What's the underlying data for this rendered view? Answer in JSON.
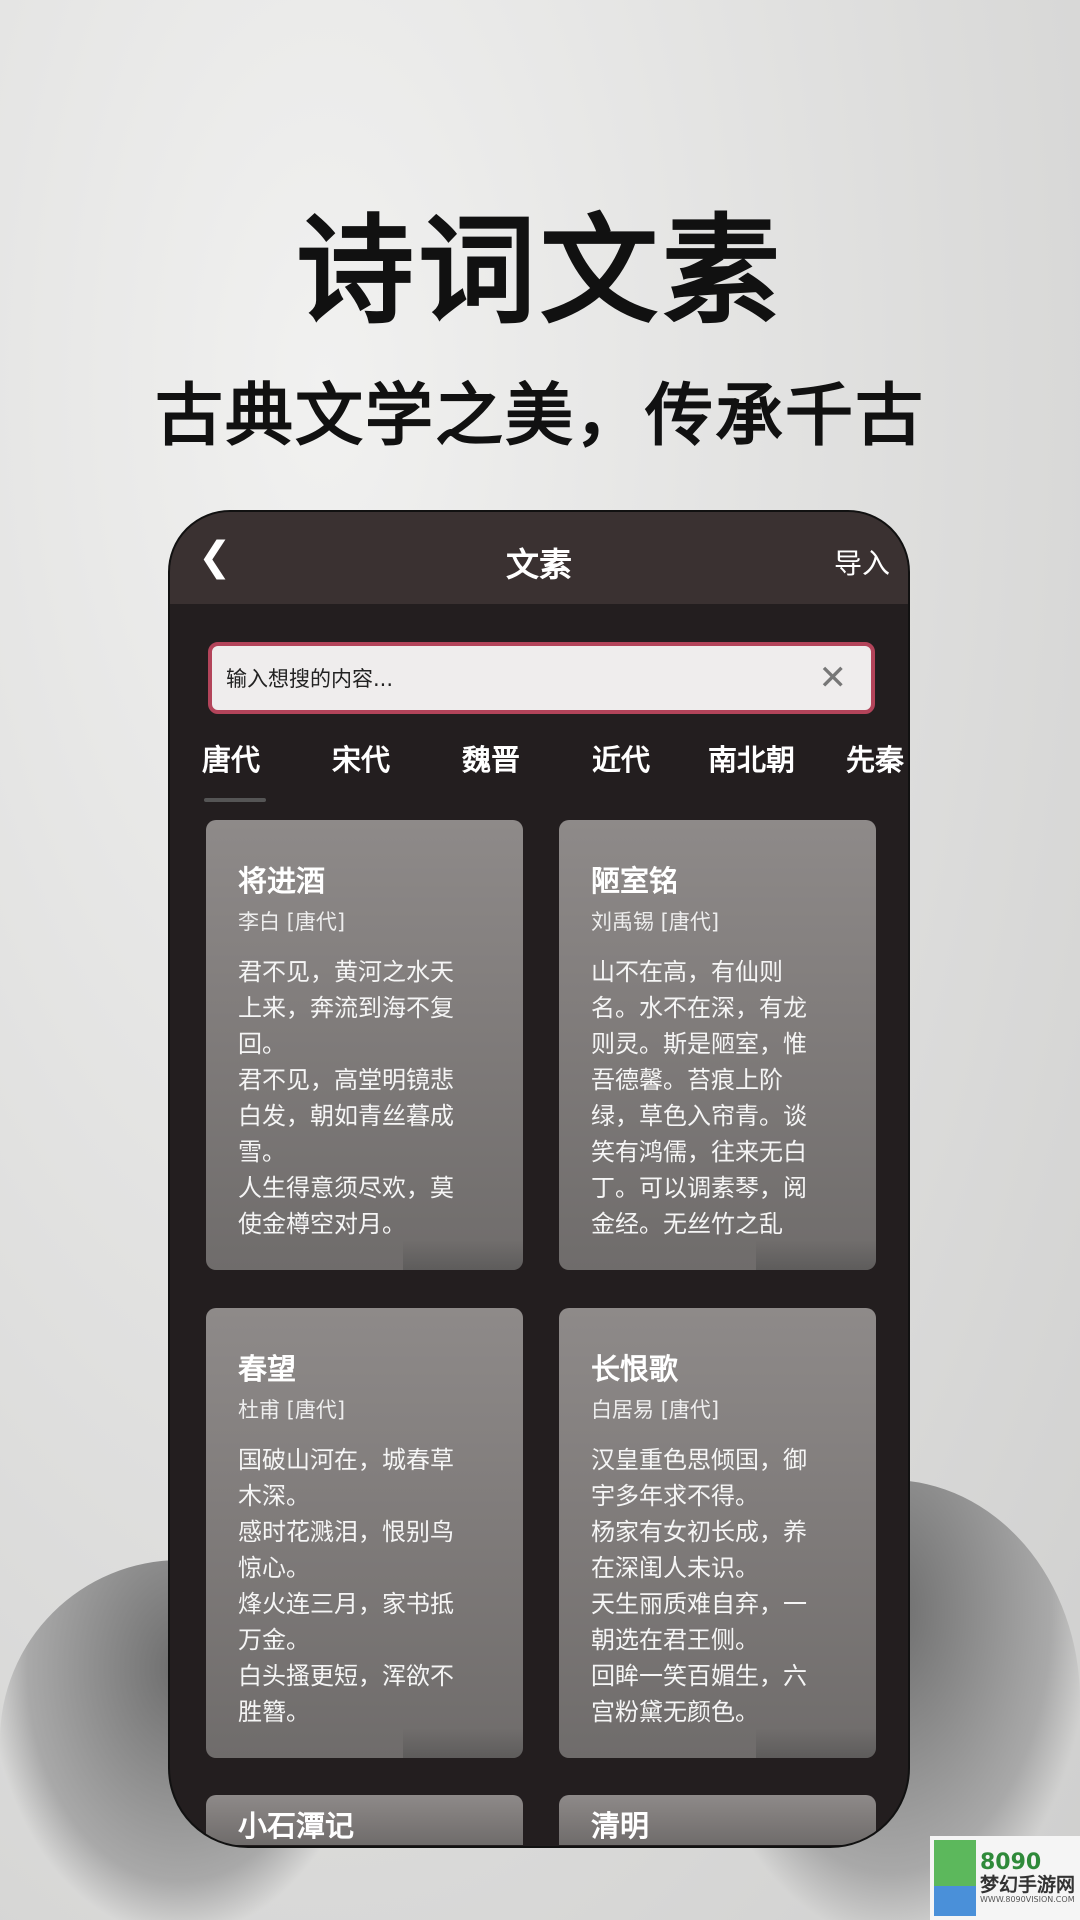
{
  "promo": {
    "headline": "诗词文素",
    "subline": "古典文学之美，传承千古"
  },
  "header": {
    "title": "文素",
    "import_label": "导入",
    "back_icon": "chevron-left-icon"
  },
  "search": {
    "placeholder": "输入想搜的内容...",
    "clear_icon": "close-icon"
  },
  "tabs": [
    {
      "label": "唐代",
      "active": true
    },
    {
      "label": "宋代"
    },
    {
      "label": "魏晋"
    },
    {
      "label": "近代"
    },
    {
      "label": "南北朝"
    },
    {
      "label": "先秦"
    }
  ],
  "cards": [
    {
      "title": "将进酒",
      "author": "李白 [唐代]",
      "text": "君不见，黄河之水天\n上来，奔流到海不复\n回。\n君不见，高堂明镜悲\n白发，朝如青丝暮成\n雪。\n人生得意须尽欢，莫\n使金樽空对月。"
    },
    {
      "title": "陋室铭",
      "author": "刘禹锡 [唐代]",
      "text": "山不在高，有仙则\n名。水不在深，有龙\n则灵。斯是陋室，惟\n吾德馨。苔痕上阶\n绿，草色入帘青。谈\n笑有鸿儒，往来无白\n丁。可以调素琴，阅\n金经。无丝竹之乱"
    },
    {
      "title": "春望",
      "author": "杜甫 [唐代]",
      "text": "国破山河在，城春草\n木深。\n感时花溅泪，恨别鸟\n惊心。\n烽火连三月，家书抵\n万金。\n白头搔更短，浑欲不\n胜簪。"
    },
    {
      "title": "长恨歌",
      "author": "白居易 [唐代]",
      "text": "汉皇重色思倾国，御\n宇多年求不得。\n杨家有女初长成，养\n在深闺人未识。\n天生丽质难自弃，一\n朝选在君王侧。\n回眸一笑百媚生，六\n宫粉黛无颜色。"
    },
    {
      "title": "小石潭记",
      "author": "",
      "text": ""
    },
    {
      "title": "清明",
      "author": "",
      "text": ""
    }
  ],
  "watermark": {
    "number": "8090",
    "name": "梦幻手游网",
    "url": "WWW.8090VISION.COM"
  }
}
